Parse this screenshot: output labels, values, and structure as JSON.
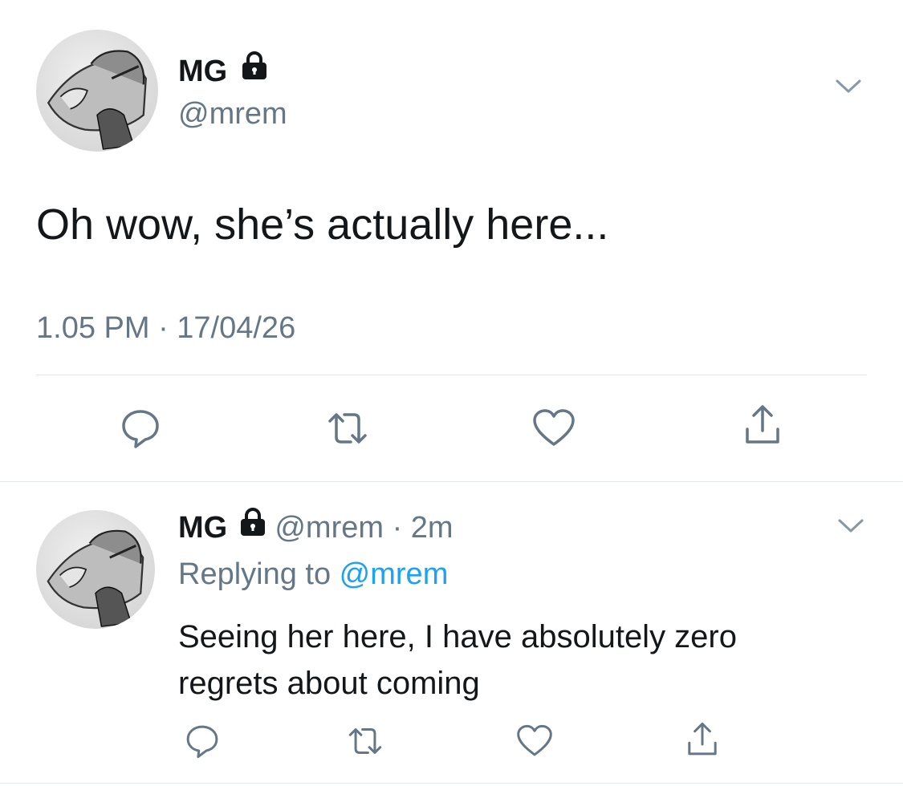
{
  "main_tweet": {
    "author_name": "MG",
    "author_handle": "@mrem",
    "text": "Oh wow, she’s actually here...",
    "timestamp": "1.05 PM · 17/04/26"
  },
  "reply_tweet": {
    "author_name": "MG",
    "author_handle": "@mrem",
    "separator": "·",
    "age": "2m",
    "replying_prefix": "Replying to ",
    "replying_handle": "@mrem",
    "text_line1": "Seeing her here, I have absolutely zero",
    "text_line2": "regrets about coming"
  },
  "icons": {
    "protected": "lock-icon",
    "more": "chevron-down-icon",
    "reply": "reply-icon",
    "retweet": "retweet-icon",
    "like": "heart-icon",
    "share": "share-icon"
  },
  "colors": {
    "text": "#14171a",
    "secondary": "#657786",
    "link": "#1da1f2",
    "icon": "#657786",
    "divider": "#e1e8ed"
  }
}
